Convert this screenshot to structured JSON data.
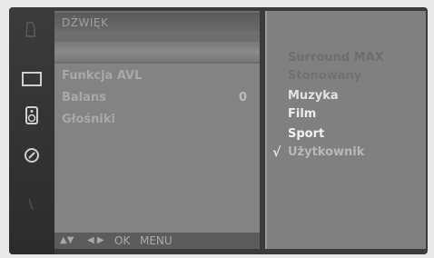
{
  "menu": {
    "title": "DŹWIĘK",
    "items": [
      {
        "label": "Funkcja AVL",
        "value": ""
      },
      {
        "label": "Balans",
        "value": "0"
      },
      {
        "label": "Głośniki",
        "value": ""
      }
    ]
  },
  "submenu": {
    "options": [
      {
        "label": "Surround MAX",
        "selected": false
      },
      {
        "label": "Stonowany",
        "selected": false
      },
      {
        "label": "Muzyka",
        "selected": false
      },
      {
        "label": "Film",
        "selected": false
      },
      {
        "label": "Sport",
        "selected": false
      },
      {
        "label": "Użytkownik",
        "selected": true
      }
    ],
    "check_mark": "√"
  },
  "navigation": {
    "arrows_updown": "▲▼",
    "arrows_leftright": "◀ ▶",
    "ok": "OK",
    "menu": "MENU"
  },
  "rail_icons": [
    "picture-icon",
    "tv-icon",
    "speaker-icon",
    "clock-icon",
    "lock-icon"
  ],
  "colors": {
    "background": "#3b3b3b",
    "panel": "#838383",
    "submenu": "#808080",
    "check": "#e6e6e6"
  }
}
